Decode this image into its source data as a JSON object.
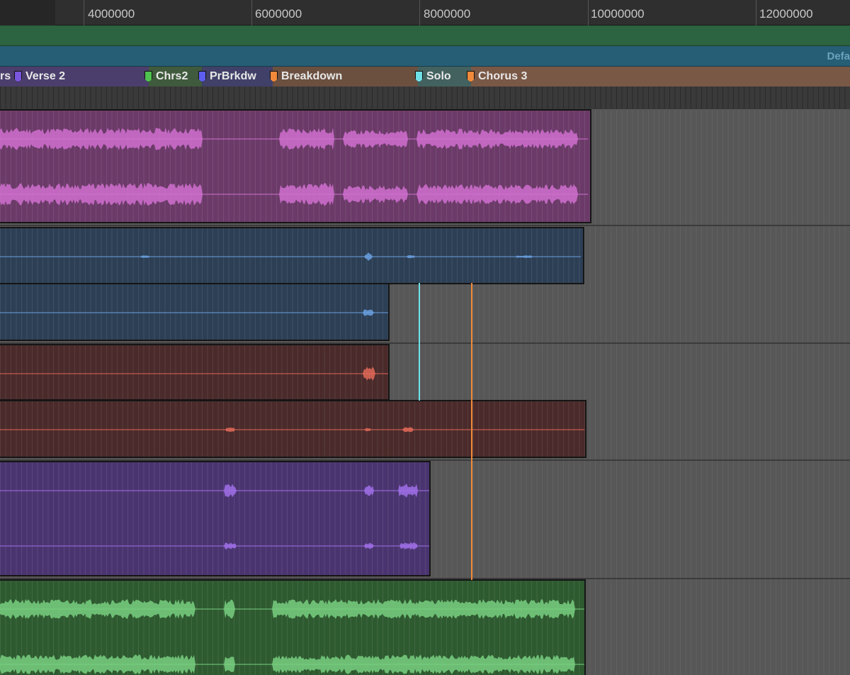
{
  "ruler": {
    "labels": [
      "4000000",
      "6000000",
      "8000000",
      "10000000",
      "12000000"
    ]
  },
  "tempo_lane": {
    "label": "Defa"
  },
  "markers": [
    {
      "label": "rs",
      "color": "#7a55e0"
    },
    {
      "label": "Verse 2",
      "color": "#7a55e0"
    },
    {
      "label": "Chrs2",
      "color": "#4fc24f"
    },
    {
      "label": "PrBrkdw",
      "color": "#5d5df0"
    },
    {
      "label": "Breakdown",
      "color": "#f08a3a"
    },
    {
      "label": "Solo",
      "color": "#6fe0e8"
    },
    {
      "label": "Chorus 3",
      "color": "#f08a3a"
    }
  ],
  "tracks": [
    {
      "name": "magenta-track",
      "color": "#6b3a68",
      "wave": "#d070d0"
    },
    {
      "name": "blue-track",
      "color": "#2c3f55",
      "wave": "#6aa0e0"
    },
    {
      "name": "red-track",
      "color": "#4a2a2a",
      "wave": "#e06858"
    },
    {
      "name": "purple-track",
      "color": "#4a3470",
      "wave": "#a070e8"
    },
    {
      "name": "green-track",
      "color": "#2e5a30",
      "wave": "#78d080"
    }
  ]
}
